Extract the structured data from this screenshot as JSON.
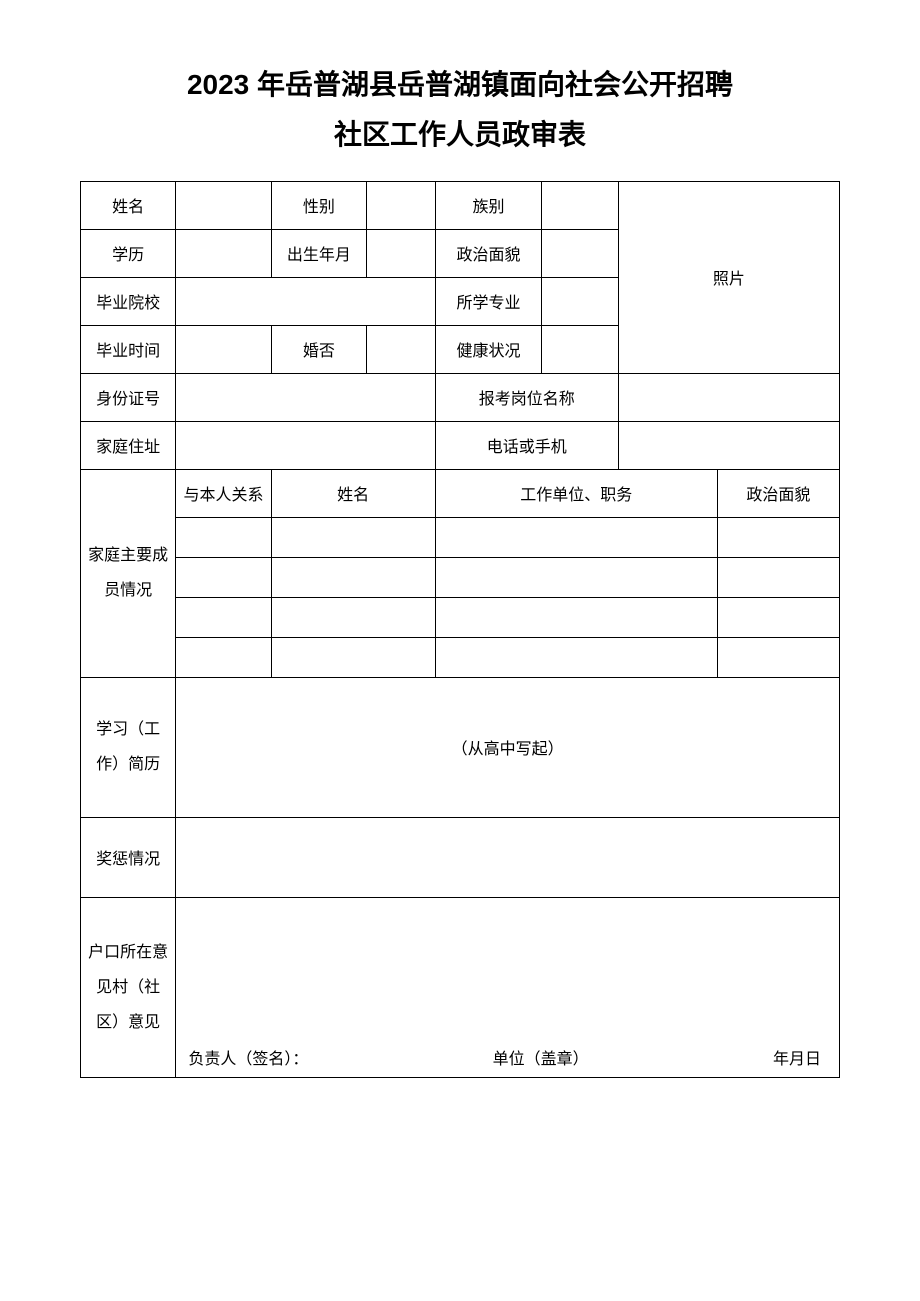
{
  "title_line1": "2023 年岳普湖县岳普湖镇面向社会公开招聘",
  "title_line2": "社区工作人员政审表",
  "labels": {
    "name": "姓名",
    "gender": "性别",
    "ethnicity": "族别",
    "education": "学历",
    "birth": "出生年月",
    "political": "政治面貌",
    "school": "毕业院校",
    "major": "所学专业",
    "grad_time": "毕业时间",
    "married": "婚否",
    "health": "健康状况",
    "id_number": "身份证号",
    "position": "报考岗位名称",
    "address": "家庭住址",
    "phone": "电话或手机",
    "photo": "照片",
    "family_section": "家庭主要成员情况",
    "relation": "与本人关系",
    "fm_name": "姓名",
    "fm_work": "工作单位、职务",
    "fm_political": "政治面貌",
    "resume_label": "学习（工作）简历",
    "resume_hint": "（从高中写起）",
    "rewards": "奖惩情况",
    "opinion1_label": "户口所在意见村（社区）意见",
    "sign_person": "负责人（签名）：",
    "sign_unit": "单位（盖章）",
    "sign_date": "年月日"
  },
  "values": {
    "name": "",
    "gender": "",
    "ethnicity": "",
    "education": "",
    "birth": "",
    "political": "",
    "school": "",
    "major": "",
    "grad_time": "",
    "married": "",
    "health": "",
    "id_number": "",
    "position": "",
    "address": "",
    "phone": "",
    "rewards": ""
  },
  "family": [
    {
      "relation": "",
      "name": "",
      "work": "",
      "political": ""
    },
    {
      "relation": "",
      "name": "",
      "work": "",
      "political": ""
    },
    {
      "relation": "",
      "name": "",
      "work": "",
      "political": ""
    },
    {
      "relation": "",
      "name": "",
      "work": "",
      "political": ""
    }
  ]
}
